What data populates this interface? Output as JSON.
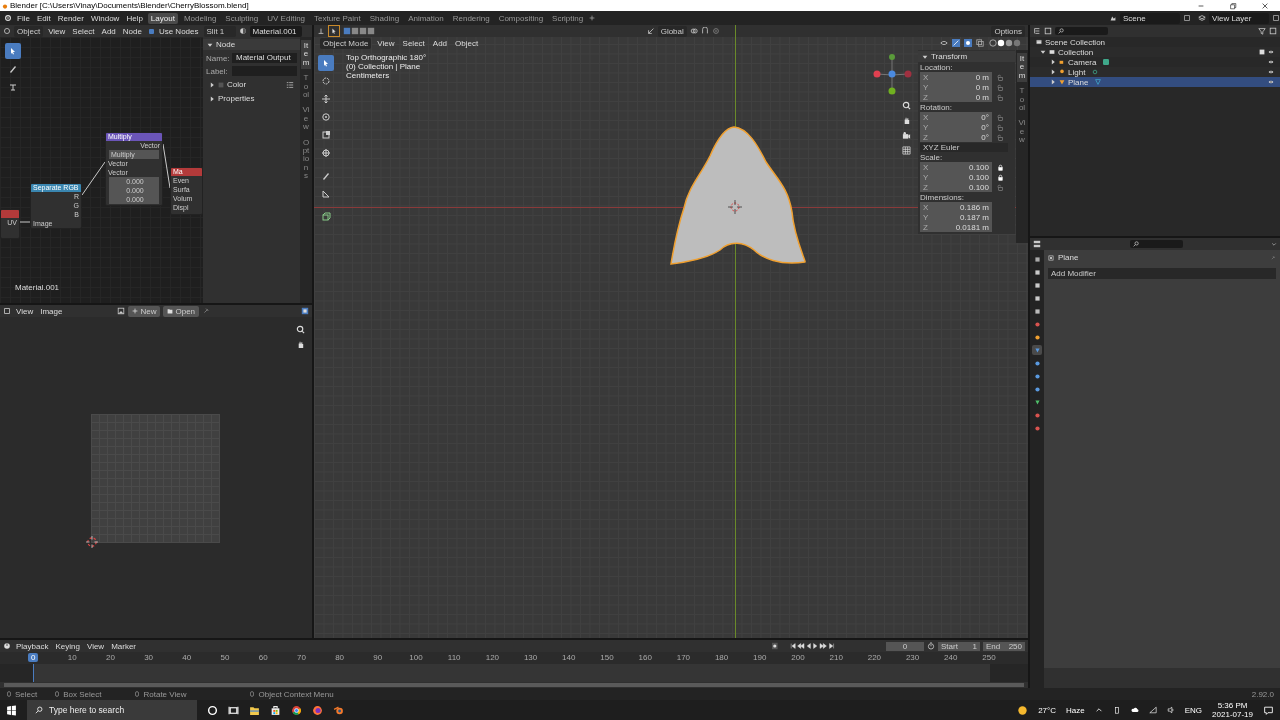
{
  "window": {
    "title": "Blender [C:\\Users\\Vinay\\Documents\\Blender\\CherryBlossom.blend]"
  },
  "menubar": [
    "File",
    "Edit",
    "Render",
    "Window",
    "Help"
  ],
  "workspaces": [
    {
      "label": "Layout",
      "selected": true
    },
    {
      "label": "Modeling",
      "selected": false
    },
    {
      "label": "Sculpting",
      "selected": false
    },
    {
      "label": "UV Editing",
      "selected": false
    },
    {
      "label": "Texture Paint",
      "selected": false
    },
    {
      "label": "Shading",
      "selected": false
    },
    {
      "label": "Animation",
      "selected": false
    },
    {
      "label": "Rendering",
      "selected": false
    },
    {
      "label": "Compositing",
      "selected": false
    },
    {
      "label": "Scripting",
      "selected": false
    }
  ],
  "scene": "Scene",
  "view_layer": "View Layer",
  "node_editor": {
    "mode": "Object",
    "menus": [
      "View",
      "Select",
      "Add",
      "Node"
    ],
    "use_nodes": {
      "label": "Use Nodes",
      "checked": true
    },
    "slot": "Slit 1",
    "material": "Material.001",
    "nodes": [
      {
        "kind": "left",
        "outputs": [
          "UV"
        ]
      },
      {
        "kind": "separate",
        "title": "Separate RGB",
        "outputs": [
          "R",
          "G",
          "B"
        ],
        "inputs": [
          "Image"
        ]
      },
      {
        "kind": "multiply",
        "title": "Multiply",
        "output": "Vector",
        "operation": "Multiply",
        "inputs": [
          "Vector",
          "Vector"
        ],
        "values": [
          "0.000",
          "0.000",
          "0.000"
        ]
      },
      {
        "kind": "output",
        "title": "Ma",
        "inputs": [
          "Even",
          "Surfa",
          "Volum",
          "Displ"
        ]
      }
    ],
    "material_label": "Material.001",
    "sidebar": {
      "section": "Node",
      "name_label": "Name:",
      "name_value": "Material Output",
      "label_label": "Label:",
      "color_label": "Color",
      "properties": "Properties",
      "tabs": [
        {
          "label": "Item",
          "selected": true
        },
        {
          "label": "Tool",
          "selected": false
        },
        {
          "label": "View",
          "selected": false
        },
        {
          "label": "Options",
          "selected": false
        }
      ]
    }
  },
  "image_editor": {
    "menus": [
      "View",
      "Image"
    ],
    "new": "New",
    "open": "Open"
  },
  "viewport": {
    "orientation": "Global",
    "options": "Options",
    "mode": "Object Mode",
    "menus": [
      "View",
      "Select",
      "Add",
      "Object"
    ],
    "overlay_text": [
      "Top Orthographic 180°",
      "(0) Collection | Plane",
      "Centimeters"
    ],
    "tabs": [
      {
        "label": "Item",
        "selected": true
      },
      {
        "label": "Tool",
        "selected": false
      },
      {
        "label": "View",
        "selected": false
      }
    ],
    "transform": {
      "title": "Transform",
      "groups": [
        {
          "label": "Location:",
          "fields": [
            {
              "axis": "X",
              "value": "0 m",
              "locked": false
            },
            {
              "axis": "Y",
              "value": "0 m",
              "locked": false
            },
            {
              "axis": "Z",
              "value": "0 m",
              "locked": false
            }
          ]
        },
        {
          "label": "Rotation:",
          "fields": [
            {
              "axis": "X",
              "value": "0°",
              "locked": false
            },
            {
              "axis": "Y",
              "value": "0°",
              "locked": false
            },
            {
              "axis": "Z",
              "value": "0°",
              "locked": false
            }
          ],
          "mode": "XYZ Euler"
        },
        {
          "label": "Scale:",
          "fields": [
            {
              "axis": "X",
              "value": "0.100",
              "locked": true
            },
            {
              "axis": "Y",
              "value": "0.100",
              "locked": true
            },
            {
              "axis": "Z",
              "value": "0.100",
              "locked": false
            }
          ]
        },
        {
          "label": "Dimensions:",
          "fields": [
            {
              "axis": "X",
              "value": "0.186 m"
            },
            {
              "axis": "Y",
              "value": "0.187 m"
            },
            {
              "axis": "Z",
              "value": "0.0181 m"
            }
          ]
        }
      ]
    }
  },
  "outliner": {
    "tree": [
      {
        "label": "Scene Collection",
        "kind": "scene",
        "children": [
          {
            "label": "Collection",
            "kind": "collection",
            "expanded": true,
            "selected": false,
            "children": [
              {
                "label": "Camera",
                "kind": "camera",
                "selected": false
              },
              {
                "label": "Light",
                "kind": "light",
                "selected": false
              },
              {
                "label": "Plane",
                "kind": "mesh",
                "selected": true
              }
            ]
          }
        ]
      }
    ]
  },
  "properties": {
    "object": "Plane",
    "add_modifier": "Add Modifier",
    "tabs": [
      {
        "kind": "tool",
        "selected": false
      },
      {
        "kind": "render",
        "selected": false
      },
      {
        "kind": "output",
        "selected": false
      },
      {
        "kind": "view_layer",
        "selected": false
      },
      {
        "kind": "scene",
        "selected": false
      },
      {
        "kind": "world",
        "selected": false
      },
      {
        "kind": "object",
        "selected": false
      },
      {
        "kind": "modifiers",
        "selected": true
      },
      {
        "kind": "particles",
        "selected": false
      },
      {
        "kind": "physics",
        "selected": false
      },
      {
        "kind": "constraints",
        "selected": false
      },
      {
        "kind": "data",
        "selected": false
      },
      {
        "kind": "material",
        "selected": false
      },
      {
        "kind": "texture",
        "selected": false
      }
    ]
  },
  "timeline": {
    "menus": [
      "Playback",
      "Keying",
      "View",
      "Marker"
    ],
    "current_frame": "0",
    "start_label": "Start",
    "start": "1",
    "end_label": "End",
    "end": "250",
    "marker": "0",
    "ticks": [
      "10",
      "20",
      "30",
      "40",
      "50",
      "60",
      "70",
      "80",
      "90",
      "100",
      "110",
      "120",
      "130",
      "140",
      "150",
      "160",
      "170",
      "180",
      "190",
      "200",
      "210",
      "220",
      "230",
      "240",
      "250"
    ]
  },
  "status_bar": {
    "items": [
      "Select",
      "Box Select",
      "Rotate View",
      "Object Context Menu"
    ],
    "version": "2.92.0"
  },
  "taskbar": {
    "search_placeholder": "Type here to search",
    "temperature": "27°C",
    "weather": "Haze",
    "language": "ENG",
    "time": "5:36 PM",
    "date": "2021-07-19"
  }
}
